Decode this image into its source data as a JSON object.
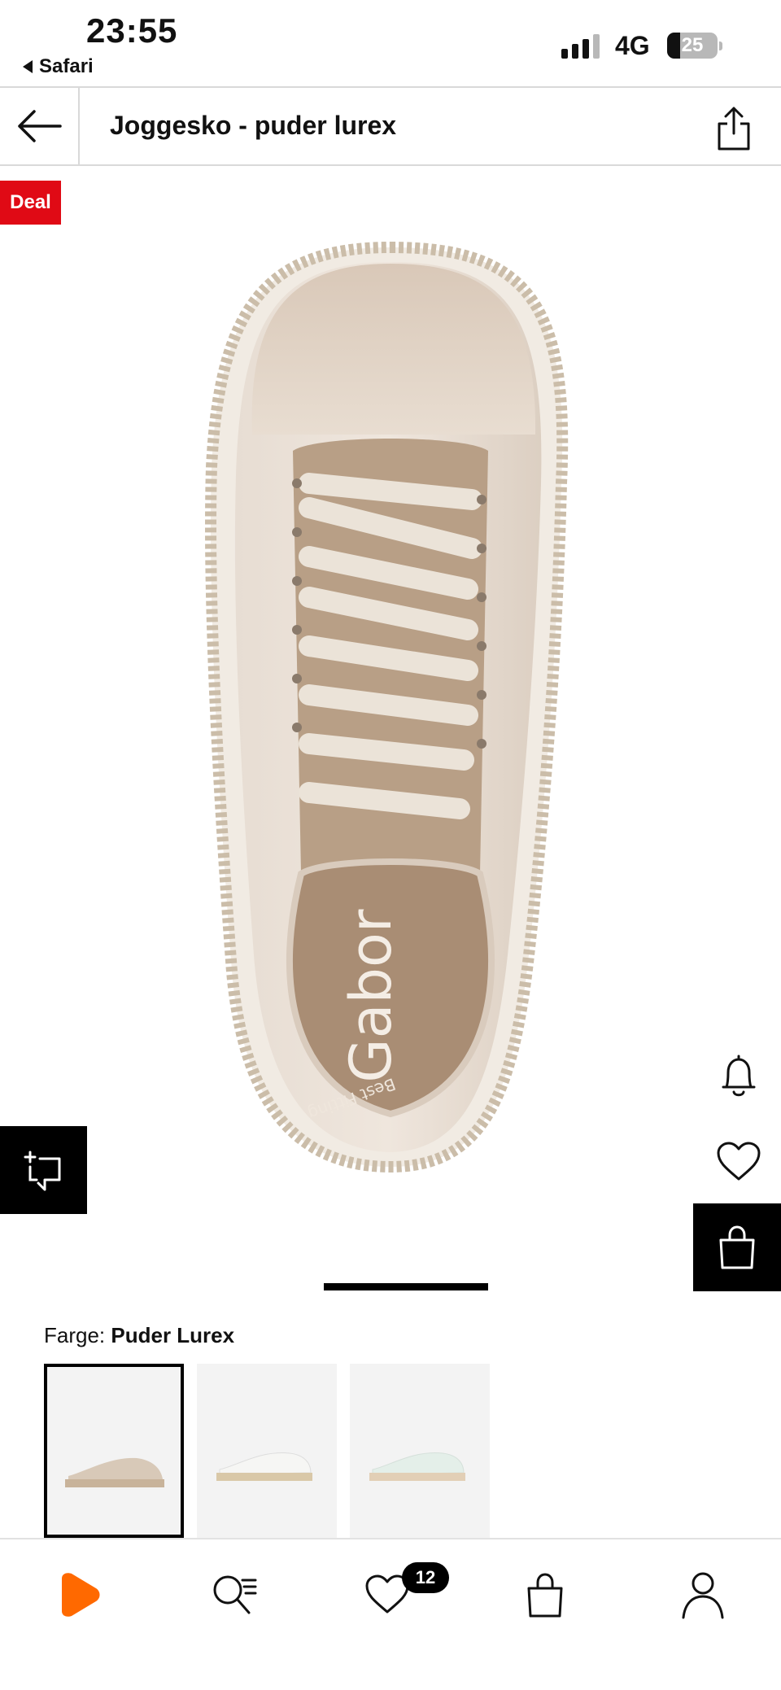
{
  "status_bar": {
    "time": "23:55",
    "back_app": "Safari",
    "network": "4G",
    "battery_level": "25",
    "battery_fraction": 0.25
  },
  "header": {
    "title": "Joggesko - puder lurex",
    "back_icon": "arrow-left-icon",
    "share_icon": "share-icon"
  },
  "gallery": {
    "deal_badge": "Deal",
    "logo_text": "Gabor",
    "insole_text": "Best Fitting",
    "image_index": 1,
    "compare_icon": "compare-icon",
    "notify_icon": "bell-icon",
    "wish_icon": "heart-icon",
    "cart_icon": "bag-icon"
  },
  "colors": {
    "label": "Farge:",
    "selected": "Puder Lurex",
    "swatches": [
      {
        "name": "puder-lurex",
        "color": "#d8c9b8",
        "selected": true
      },
      {
        "name": "white",
        "color": "#f4f4f2",
        "selected": false
      },
      {
        "name": "mint",
        "color": "#e4efe9",
        "selected": false
      }
    ]
  },
  "bottom_nav": {
    "items": [
      "home-icon",
      "search-icon",
      "heart-icon",
      "bag-icon",
      "profile-icon"
    ],
    "wishlist_count": "12"
  },
  "theme": {
    "accent": "#ff6900",
    "deal_red": "#e00a15"
  }
}
